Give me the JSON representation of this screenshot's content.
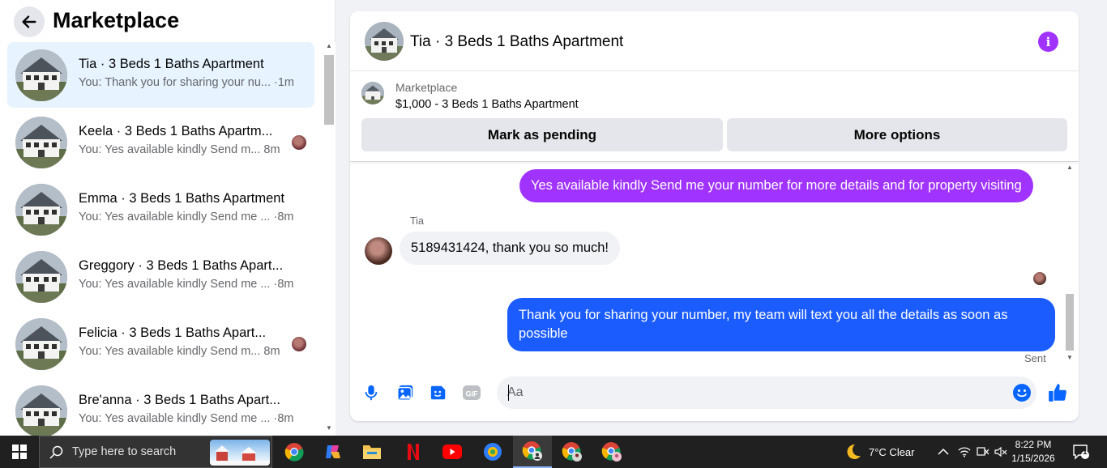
{
  "left": {
    "title": "Marketplace",
    "conversations": [
      {
        "name": "Tia · 3 Beds 1 Baths Apartment",
        "preview": "You: Thank you for sharing your nu... ·1m",
        "active": true,
        "avatar": false
      },
      {
        "name": "Keela · 3 Beds 1 Baths Apartm...",
        "preview": "You: Yes available kindly Send m... 8m",
        "active": false,
        "avatar": true
      },
      {
        "name": "Emma · 3 Beds 1 Baths Apartment",
        "preview": "You: Yes available kindly Send me ... ·8m",
        "active": false,
        "avatar": false
      },
      {
        "name": "Greggory · 3 Beds 1 Baths Apart...",
        "preview": "You: Yes available kindly Send me ... ·8m",
        "active": false,
        "avatar": false
      },
      {
        "name": "Felicia · 3 Beds 1 Baths Apart...",
        "preview": "You: Yes available kindly Send m... 8m",
        "active": false,
        "avatar": true
      },
      {
        "name": "Bre'anna · 3 Beds 1 Baths Apart...",
        "preview": "You: Yes available kindly Send me ... ·8m",
        "active": false,
        "avatar": false
      }
    ]
  },
  "chat": {
    "title": "Tia · 3 Beds 1 Baths Apartment",
    "listing": {
      "label": "Marketplace",
      "subtitle": "$1,000 - 3 Beds 1 Baths Apartment",
      "mark_pending": "Mark as pending",
      "more_options": "More options"
    },
    "messages": {
      "out1": "Yes available kindly Send me your number for more details and for property visiting",
      "sender": "Tia",
      "in1": "5189431424, thank you so much!",
      "out2": "Thank you for  sharing your number, my team will text you all the details as soon as possible",
      "status": "Sent"
    },
    "composer": {
      "placeholder": "Aa"
    }
  },
  "taskbar": {
    "search_placeholder": "Type here to search",
    "weather": "7°C  Clear",
    "time": "8:22 PM",
    "date": "1/15/2026",
    "notification_count": "1"
  },
  "colors": {
    "outgoing_purple": "#a033ff",
    "outgoing_blue": "#1b5cff",
    "accent": "#0866ff"
  }
}
